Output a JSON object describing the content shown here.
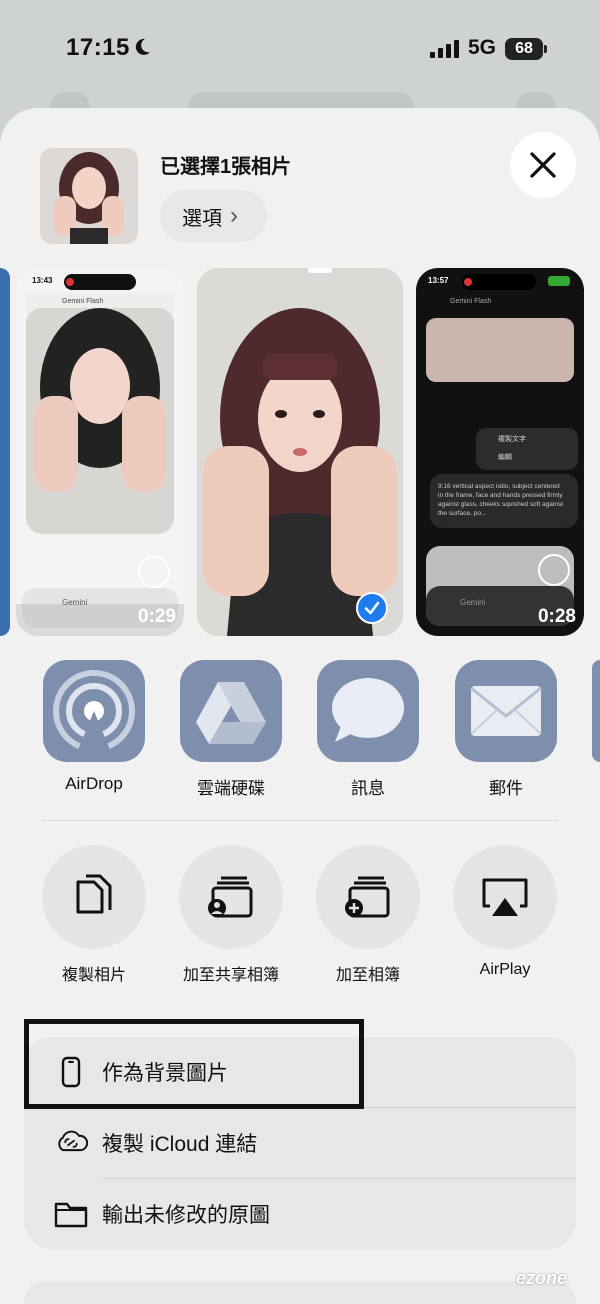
{
  "status_bar": {
    "time": "17:15",
    "network": "5G",
    "battery": "68"
  },
  "header": {
    "title": "已選擇1張相片",
    "options_label": "選項",
    "options_chevron": "›"
  },
  "photos": [
    {
      "duration": "0:29",
      "app_time": "13:43",
      "app_title": "Gemini Flash",
      "input_placeholder": "Gemini"
    },
    {
      "selected": true
    },
    {
      "duration": "0:28",
      "app_time": "13:57",
      "app_title": "Gemini Flash",
      "menu_copy": "複製文字",
      "menu_edit": "編輯",
      "prompt_text": "9:16 vertical aspect ratio, subject centered in the frame, face and hands pressed firmly against glass, cheeks squished soft against the surface, po...",
      "input_placeholder": "Gemini"
    }
  ],
  "share_apps": [
    {
      "label": "AirDrop",
      "icon": "airdrop-icon"
    },
    {
      "label": "雲端硬碟",
      "icon": "drive-icon"
    },
    {
      "label": "訊息",
      "icon": "messages-icon"
    },
    {
      "label": "郵件",
      "icon": "mail-icon"
    }
  ],
  "actions": [
    {
      "label": "複製相片",
      "icon": "copy-icon"
    },
    {
      "label": "加至共享相簿",
      "icon": "shared-album-icon"
    },
    {
      "label": "加至相簿",
      "icon": "add-album-icon"
    },
    {
      "label": "AirPlay",
      "icon": "airplay-icon"
    }
  ],
  "list_actions": [
    {
      "label": "作為背景圖片",
      "icon": "phone-icon"
    },
    {
      "label": "複製 iCloud 連結",
      "icon": "link-icon"
    },
    {
      "label": "輸出未修改的原圖",
      "icon": "folder-icon"
    }
  ],
  "watermark": "ezone",
  "colors": {
    "accent": "#1e7cf1",
    "app_icon_bg": "#7e8fae",
    "sheet_bg": "#f0f1f0"
  }
}
